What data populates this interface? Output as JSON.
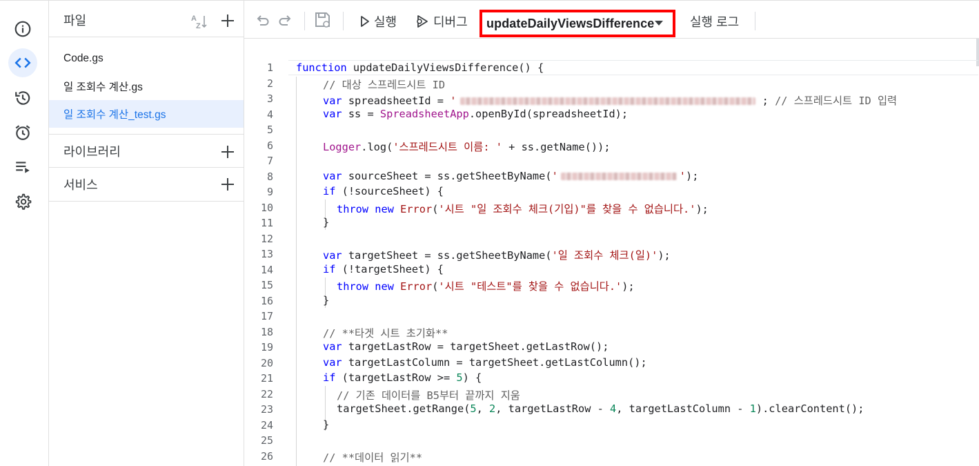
{
  "rail": {
    "items": [
      {
        "name": "info-icon"
      },
      {
        "name": "code-icon"
      },
      {
        "name": "history-icon"
      },
      {
        "name": "alarm-icon"
      },
      {
        "name": "executions-icon"
      },
      {
        "name": "settings-icon"
      }
    ],
    "active_index": 1,
    "accent": "#1a73e8"
  },
  "files_panel": {
    "title": "파일",
    "files": [
      {
        "label": "Code.gs"
      },
      {
        "label": "일 조회수 계산.gs"
      },
      {
        "label": "일 조회수 계산_test.gs"
      }
    ],
    "selected_index": 2,
    "libraries_label": "라이브러리",
    "services_label": "서비스"
  },
  "toolbar": {
    "run_label": "실행",
    "debug_label": "디버그",
    "function_name": "updateDailyViewsDifference",
    "log_label": "실행 로그",
    "highlight_color": "#ff0000"
  },
  "editor": {
    "line_numbers": [
      "1",
      "2",
      "3",
      "4",
      "5",
      "6",
      "7",
      "8",
      "9",
      "10",
      "11",
      "12",
      "13",
      "14",
      "15",
      "16",
      "17",
      "18",
      "19",
      "20",
      "21",
      "22",
      "23",
      "24",
      "25",
      "26"
    ],
    "code": {
      "l1_kw": "function",
      "l1_rest": " updateDailyViewsDifference() {",
      "l2": "// 대상 스프레드시트 ID",
      "l3_kw": "var",
      "l3_a": " spreadsheetId = ",
      "l3_q": "'",
      "l3_b": " ; ",
      "l3_cm": "// 스프레드시트 ID 입력",
      "l4_kw": "var",
      "l4_a": " ss = ",
      "l4_obj": "SpreadsheetApp",
      "l4_b": ".openById(spreadsheetId);",
      "l6_obj": "Logger",
      "l6_a": ".log(",
      "l6_str": "'스프레드시트 이름: '",
      "l6_b": " + ss.getName());",
      "l8_kw": "var",
      "l8_a": " sourceSheet = ss.getSheetByName(",
      "l8_q1": "'",
      "l8_q2": "'",
      "l8_b": ");",
      "l9_kw": "if",
      "l9_a": " (!sourceSheet) {",
      "l10_kw1": "throw",
      "l10_kw2": "new",
      "l10_err": "Error",
      "l10_a": "(",
      "l10_str": "'시트 \"일 조회수 체크(기입)\"를 찾을 수 없습니다.'",
      "l10_b": ");",
      "close": "}",
      "l13_kw": "var",
      "l13_a": " targetSheet = ss.getSheetByName(",
      "l13_str": "'일 조회수 체크(일)'",
      "l13_b": ");",
      "l14_kw": "if",
      "l14_a": " (!targetSheet) {",
      "l15_kw1": "throw",
      "l15_kw2": "new",
      "l15_err": "Error",
      "l15_a": "(",
      "l15_str": "'시트 \"테스트\"를 찾을 수 없습니다.'",
      "l15_b": ");",
      "l18": "// **타겟 시트 초기화**",
      "l19_kw": "var",
      "l19_a": " targetLastRow = targetSheet.getLastRow();",
      "l20_kw": "var",
      "l20_a": " targetLastColumn = targetSheet.getLastColumn();",
      "l21_kw": "if",
      "l21_a": " (targetLastRow >= ",
      "l21_num": "5",
      "l21_b": ") {",
      "l22": "// 기존 데이터를 B5부터 끝까지 지움",
      "l23_a": "targetSheet.getRange(",
      "l23_n1": "5",
      "l23_c1": ", ",
      "l23_n2": "2",
      "l23_b": ", targetLastRow - ",
      "l23_n3": "4",
      "l23_c": ", targetLastColumn - ",
      "l23_n4": "1",
      "l23_d": ").clearContent();",
      "l26": "// **데이터 읽기**"
    }
  }
}
